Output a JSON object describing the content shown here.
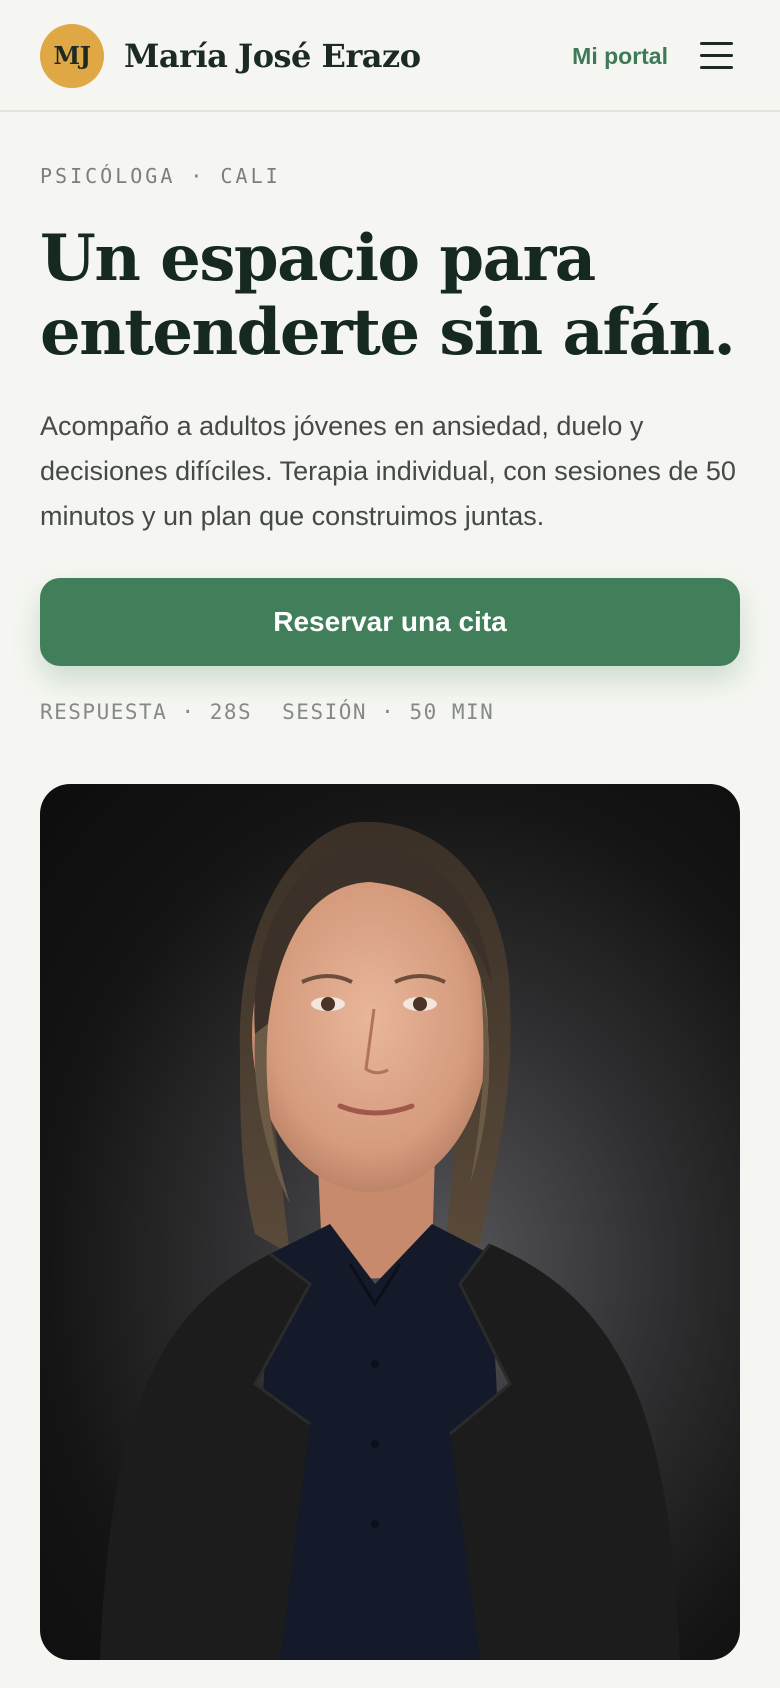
{
  "header": {
    "avatar_initials": "MJ",
    "brand_name": "María José Erazo",
    "portal_link": "Mi portal",
    "menu_icon": "hamburger-menu-icon"
  },
  "hero": {
    "eyebrow": "PSICÓLOGA · CALI",
    "title": "Un espacio para entenderte sin afán.",
    "description": "Acompaño a adultos jóvenes en ansiedad, duelo y decisiones difíciles. Terapia individual, con sesiones de 50 minutos y un plan que construimos juntas.",
    "cta_label": "Reservar una cita",
    "meta": {
      "response": "RESPUESTA · 28S",
      "session": "SESIÓN · 50 MIN"
    }
  },
  "portrait": {
    "description_icon": "portrait-photo"
  },
  "colors": {
    "background": "#f5f6f1",
    "accent": "#417e5a",
    "accent_text": "#3f7a58",
    "avatar": "#e0a844",
    "heading": "#16291f"
  }
}
